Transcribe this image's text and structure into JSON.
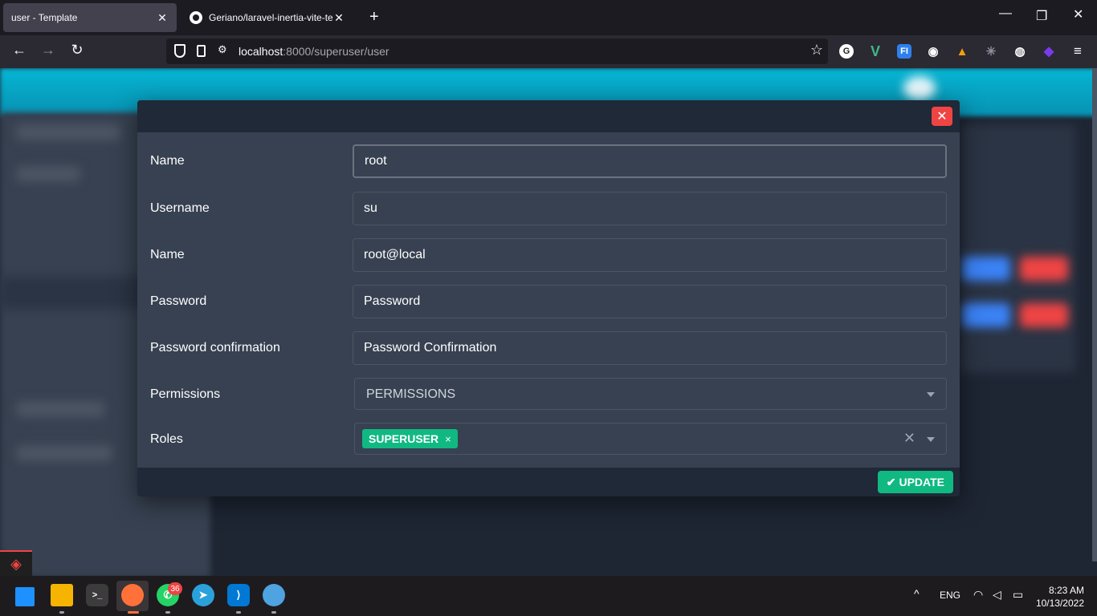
{
  "browser": {
    "tabs": [
      {
        "title": "user - Template",
        "active": true
      },
      {
        "title": "Geriano/laravel-inertia-vite-tem",
        "active": false
      }
    ],
    "url_host": "localhost",
    "url_path": ":8000/superuser/user",
    "window_controls": [
      "minimize-icon",
      "restore-icon",
      "close-icon"
    ],
    "extensions": [
      "G",
      "V",
      "FI",
      "cookie",
      "fox",
      "bug",
      "globe",
      "diamond"
    ]
  },
  "modal": {
    "fields": [
      {
        "label": "Name",
        "value": "root",
        "placeholder": ""
      },
      {
        "label": "Username",
        "value": "su",
        "placeholder": ""
      },
      {
        "label": "Name",
        "value": "root@local",
        "placeholder": ""
      },
      {
        "label": "Password",
        "value": "",
        "placeholder": "Password"
      },
      {
        "label": "Password confirmation",
        "value": "",
        "placeholder": "Password Confirmation"
      }
    ],
    "permissions": {
      "label": "Permissions",
      "placeholder": "PERMISSIONS"
    },
    "roles": {
      "label": "Roles",
      "selected": [
        "SUPERUSER"
      ]
    },
    "update_label": "UPDATE"
  },
  "taskbar": {
    "whatsapp_badge": "36",
    "language": "ENG",
    "time": "8:23 AM",
    "date": "10/13/2022"
  },
  "colors": {
    "accent_cyan": "#06b6d4",
    "success": "#10b981",
    "danger": "#ef4444",
    "modal_bg": "#374151"
  }
}
